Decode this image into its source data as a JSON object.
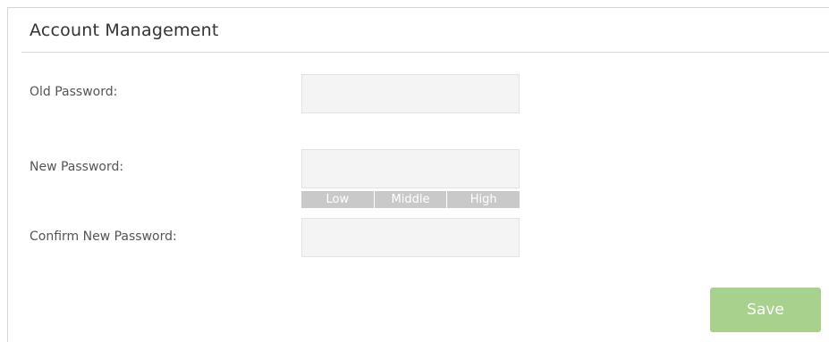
{
  "section": {
    "title": "Account Management"
  },
  "form": {
    "old_password": {
      "label": "Old Password:",
      "value": "",
      "placeholder": ""
    },
    "new_password": {
      "label": "New Password:",
      "value": "",
      "placeholder": ""
    },
    "confirm_password": {
      "label": "Confirm New Password:",
      "value": "",
      "placeholder": ""
    },
    "strength": {
      "levels": [
        "Low",
        "Middle",
        "High"
      ],
      "active": ""
    }
  },
  "actions": {
    "save_label": "Save"
  },
  "colors": {
    "save_button": "#a9d18e",
    "input_background": "#f4f4f4",
    "strength_inactive": "#c9c9c9"
  }
}
